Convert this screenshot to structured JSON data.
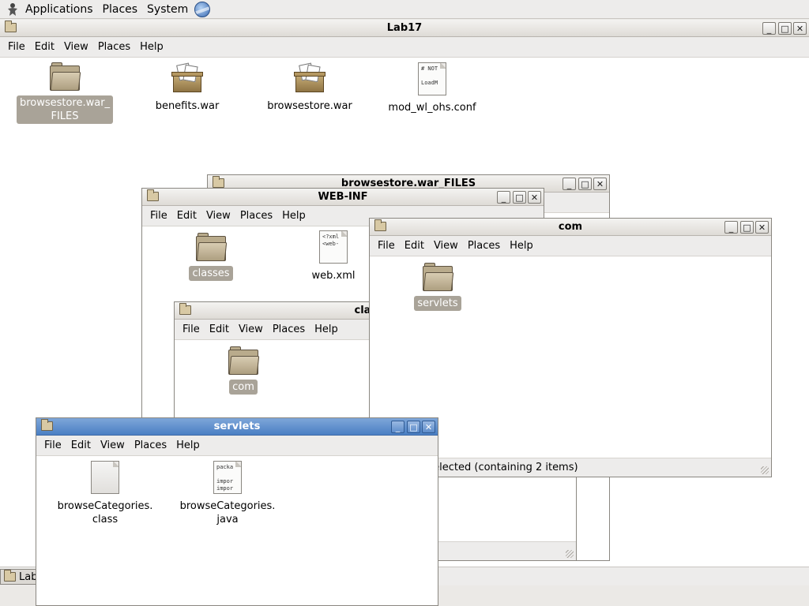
{
  "panel": {
    "menus": [
      "Applications",
      "Places",
      "System"
    ]
  },
  "menus": {
    "file": "File",
    "edit": "Edit",
    "view": "View",
    "places": "Places",
    "help": "Help"
  },
  "lab17": {
    "title": "Lab17",
    "items": [
      {
        "label1": "browsestore.war_",
        "label2": "FILES",
        "kind": "folder",
        "selected": true
      },
      {
        "label1": "benefits.war",
        "label2": "",
        "kind": "package"
      },
      {
        "label1": "browsestore.war",
        "label2": "",
        "kind": "package"
      },
      {
        "label1": "mod_wl_ohs.conf",
        "label2": "",
        "kind": "doc",
        "preview": [
          "# NOT",
          "",
          "LoadM"
        ]
      }
    ]
  },
  "browsestore_files": {
    "title": "browsestore.war_FILES"
  },
  "webinf": {
    "title": "WEB-INF",
    "items": [
      {
        "label": "classes",
        "kind": "folder",
        "selected": true
      },
      {
        "label": "web.xml",
        "kind": "doc",
        "preview": [
          "<?xml",
          "<web-"
        ]
      }
    ]
  },
  "classes": {
    "title": "classes",
    "items": [
      {
        "label": "com",
        "kind": "folder",
        "selected": true
      }
    ]
  },
  "com": {
    "title": "com",
    "items": [
      {
        "label": "servlets",
        "kind": "folder",
        "selected": true
      }
    ],
    "status": "\"servlets\" selected (containing 2 items)"
  },
  "servlets": {
    "title": "servlets",
    "items": [
      {
        "label1": "browseCategories.",
        "label2": "class",
        "kind": "doc-plain"
      },
      {
        "label1": "browseCategories.",
        "label2": "java",
        "kind": "doc",
        "preview": [
          "packa",
          "",
          "impor",
          "impor"
        ]
      }
    ]
  },
  "taskbar": {
    "lab17": "Lab"
  },
  "controls": {
    "minimize": "_",
    "maximize": "□",
    "close": "✕"
  }
}
